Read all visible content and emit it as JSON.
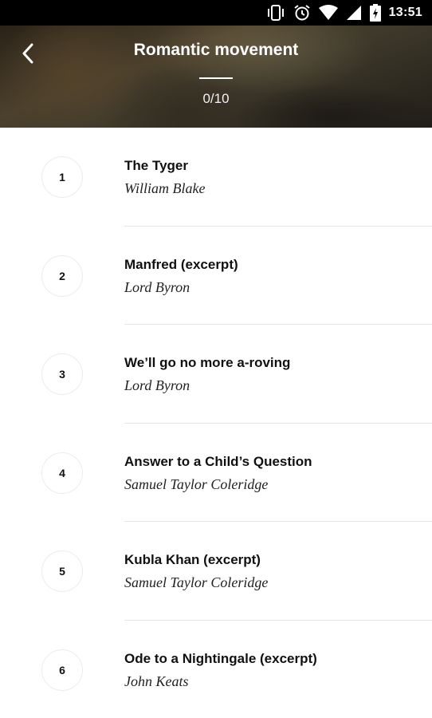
{
  "status_bar": {
    "time": "13:51",
    "icons": [
      "vibrate-icon",
      "alarm-icon",
      "wifi-icon",
      "signal-icon",
      "battery-charging-icon"
    ]
  },
  "header": {
    "back_icon": "chevron-left-icon",
    "title": "Romantic movement",
    "progress": "0/10"
  },
  "poems": [
    {
      "number": "1",
      "title": "The Tyger",
      "author": "William Blake"
    },
    {
      "number": "2",
      "title": "Manfred (excerpt)",
      "author": "Lord Byron"
    },
    {
      "number": "3",
      "title": "We’ll go no more a-roving",
      "author": "Lord Byron"
    },
    {
      "number": "4",
      "title": "Answer to a Child’s Question",
      "author": "Samuel Taylor Coleridge"
    },
    {
      "number": "5",
      "title": "Kubla Khan (excerpt)",
      "author": "Samuel Taylor Coleridge"
    },
    {
      "number": "6",
      "title": "Ode to a Nightingale (excerpt)",
      "author": "John Keats"
    }
  ]
}
